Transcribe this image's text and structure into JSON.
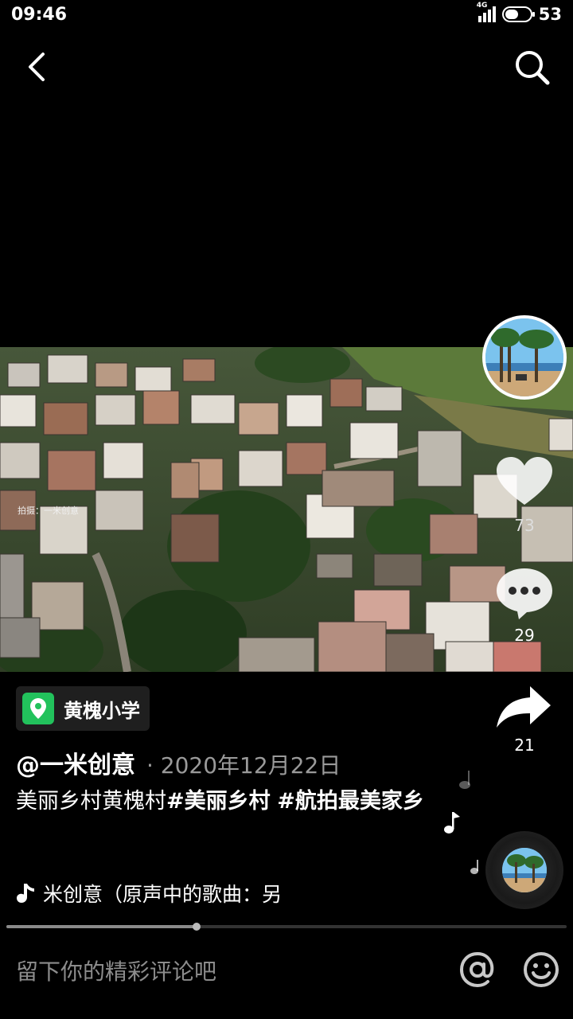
{
  "status_bar": {
    "time": "09:46",
    "network": "4G",
    "battery": "53",
    "battery_level": 0.53
  },
  "nav": {
    "back_icon": "chevron-left-icon",
    "search_icon": "search-icon"
  },
  "video": {
    "watermark": "拍摄：一米创意"
  },
  "actions": {
    "like_count": "73",
    "comment_count": "29",
    "share_count": "21"
  },
  "location": {
    "icon": "location-pin-icon",
    "label": "黄槐小学"
  },
  "post": {
    "author": "@一米创意",
    "date": "· 2020年12月22日",
    "caption_text": "美丽乡村黄槐村",
    "hashtag_1": "#美丽乡村",
    "hashtag_2": "#航拍最美家乡"
  },
  "music": {
    "text": "米创意（原声中的歌曲：另"
  },
  "playback": {
    "progress": 0.34
  },
  "comment_bar": {
    "placeholder": "留下你的精彩评论吧"
  },
  "colors": {
    "location_green": "#22c25c",
    "background": "#000000"
  }
}
